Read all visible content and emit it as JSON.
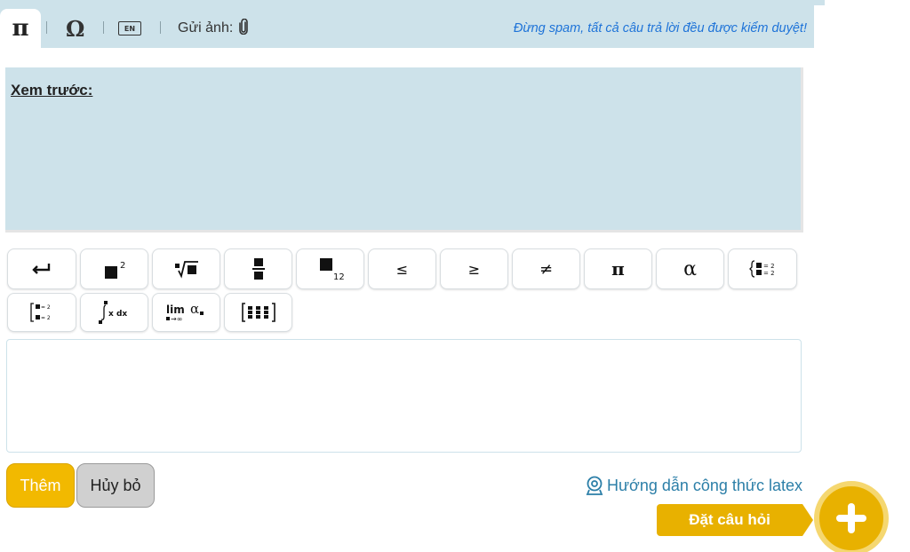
{
  "toolbar": {
    "tab_pi": "π",
    "tab_omega": "Ω",
    "keyboard_text": "EN",
    "upload_label": "Gửi ảnh:",
    "notice": "Đừng spam, tất cả câu trả lời đều được kiểm duyệt!"
  },
  "preview": {
    "title": "Xem trước:"
  },
  "keys": {
    "row1": [
      {
        "name": "enter-key",
        "symbol": "↵"
      },
      {
        "name": "power-key",
        "symbol": "■²"
      },
      {
        "name": "nth-root-key",
        "symbol": "ⁿ√■"
      },
      {
        "name": "fraction-key",
        "symbol": "■/■"
      },
      {
        "name": "subscript-key",
        "symbol": "■₁₂"
      },
      {
        "name": "leq-key",
        "symbol": "≤"
      },
      {
        "name": "geq-key",
        "symbol": "≥"
      },
      {
        "name": "neq-key",
        "symbol": "≠"
      },
      {
        "name": "pi-key",
        "symbol": "π"
      },
      {
        "name": "alpha-key",
        "symbol": "α"
      },
      {
        "name": "system-key",
        "symbol": "{■=2 ■=2"
      }
    ],
    "row2": [
      {
        "name": "bracket-system-key",
        "symbol": "[■=2 ■=2"
      },
      {
        "name": "integral-key",
        "symbol": "∫ x dx"
      },
      {
        "name": "limit-key",
        "symbol": "lim α"
      },
      {
        "name": "matrix-key",
        "symbol": "[⋮⋮⋮]"
      }
    ]
  },
  "actions": {
    "add_label": "Thêm",
    "cancel_label": "Hủy bỏ",
    "latex_help": "Hướng dẫn công thức latex",
    "ask_label": "Đặt câu hỏi"
  },
  "colors": {
    "panel": "#cde2ea",
    "accent": "#f2b900",
    "notice": "#1e73d8",
    "link": "#2c7fa8"
  }
}
